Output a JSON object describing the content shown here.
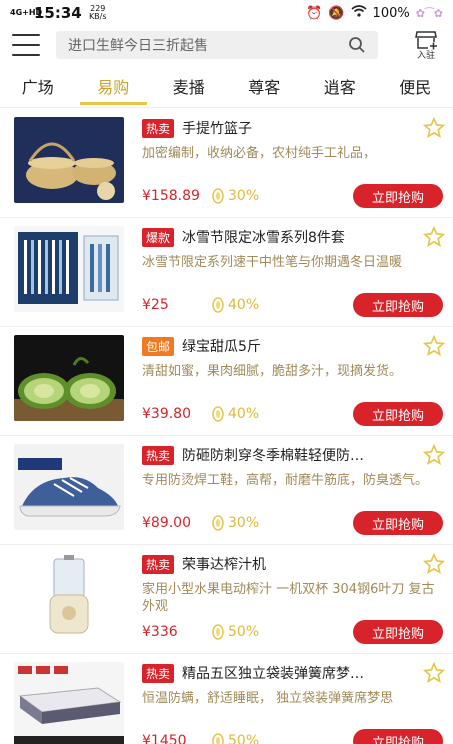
{
  "status": {
    "signal": "4G+HD",
    "time": "15:34",
    "net_speed": "229",
    "net_unit": "KB/s",
    "battery": "100%"
  },
  "search": {
    "placeholder": "进口生鲜今日三折起售"
  },
  "store": {
    "label": "入驻"
  },
  "tabs": [
    {
      "label": "广场",
      "active": false
    },
    {
      "label": "易购",
      "active": true
    },
    {
      "label": "麦播",
      "active": false
    },
    {
      "label": "尊客",
      "active": false
    },
    {
      "label": "逍客",
      "active": false
    },
    {
      "label": "便民",
      "active": false
    }
  ],
  "products": [
    {
      "tag": "热卖",
      "tag_color": "#d8232a",
      "title": "手提竹篮子",
      "desc": "加密编制，收纳必备，农村纯手工礼品，",
      "price": "¥158.89",
      "percent": "30%",
      "button": "立即抢购",
      "image": "bamboo-basket-image"
    },
    {
      "tag": "爆款",
      "tag_color": "#d8232a",
      "title": "冰雪节限定冰雪系列8件套",
      "desc": "冰雪节限定系列速干中性笔与你期遇冬日温暖",
      "price": "¥25",
      "percent": "40%",
      "button": "立即抢购",
      "image": "pen-set-image"
    },
    {
      "tag": "包邮",
      "tag_color": "#ef7a22",
      "title": "绿宝甜瓜5斤",
      "desc": "清甜如蜜，果肉细腻，脆甜多汁，现摘发货。",
      "price": "¥39.80",
      "percent": "40%",
      "button": "立即抢购",
      "image": "melon-image"
    },
    {
      "tag": "热卖",
      "tag_color": "#d8232a",
      "title": "防砸防刺穿冬季棉鞋轻便防…",
      "desc": "专用防烫焊工鞋，高帮，耐磨牛筋底，防臭透气。",
      "price": "¥89.00",
      "percent": "30%",
      "button": "立即抢购",
      "image": "shoe-image"
    },
    {
      "tag": "热卖",
      "tag_color": "#d8232a",
      "title": "荣事达榨汁机",
      "desc": "家用小型水果电动榨汁 一机双杯 304钢6叶刀 复古外观",
      "price": "¥336",
      "percent": "50%",
      "button": "立即抢购",
      "image": "juicer-image"
    },
    {
      "tag": "热卖",
      "tag_color": "#d8232a",
      "title": "精品五区独立袋装弹簧席梦…",
      "desc": "恒温防螨，舒适睡眠， 独立袋装弹簧席梦思",
      "price": "¥1450",
      "percent": "50%",
      "button": "立即抢购",
      "image": "mattress-image"
    }
  ]
}
